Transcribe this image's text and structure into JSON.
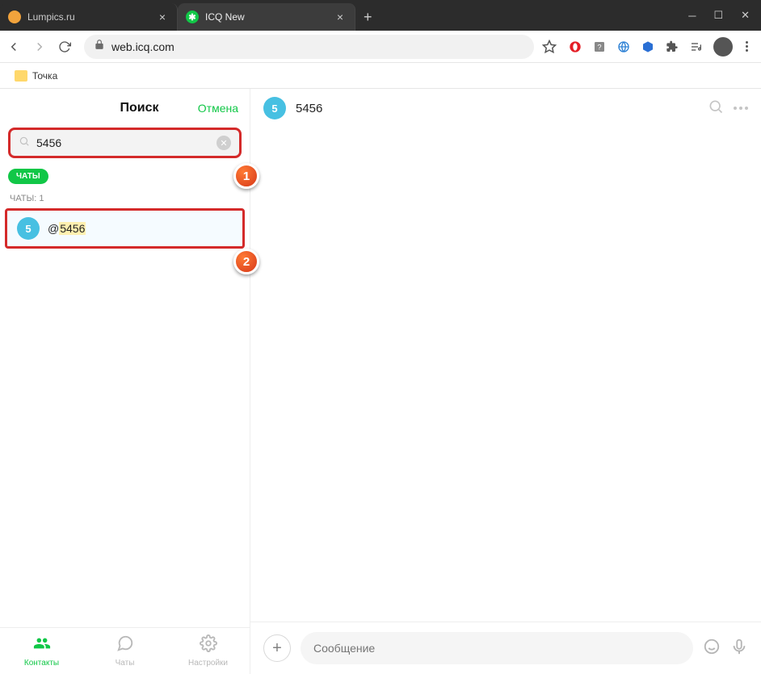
{
  "browser": {
    "tabs": [
      {
        "title": "Lumpics.ru",
        "fav_bg": "#f2a33c",
        "fav_text": ""
      },
      {
        "title": "ICQ New",
        "fav_bg": "#11c747",
        "fav_text": "✱"
      }
    ],
    "url": "web.icq.com",
    "bookmarks": [
      {
        "label": "Точка"
      }
    ]
  },
  "sidebar": {
    "search_title": "Поиск",
    "cancel_label": "Отмена",
    "search_value": "5456",
    "chip_label": "ЧАТЫ",
    "section_label": "ЧАТЫ: 1",
    "result": {
      "avatar": "5",
      "prefix": "@",
      "highlight": "5456"
    },
    "nav": {
      "contacts": "Контакты",
      "chats": "Чаты",
      "settings": "Настройки"
    }
  },
  "chat": {
    "title": "5456",
    "avatar": "5",
    "composer_placeholder": "Сообщение"
  },
  "callouts": {
    "one": "1",
    "two": "2"
  }
}
